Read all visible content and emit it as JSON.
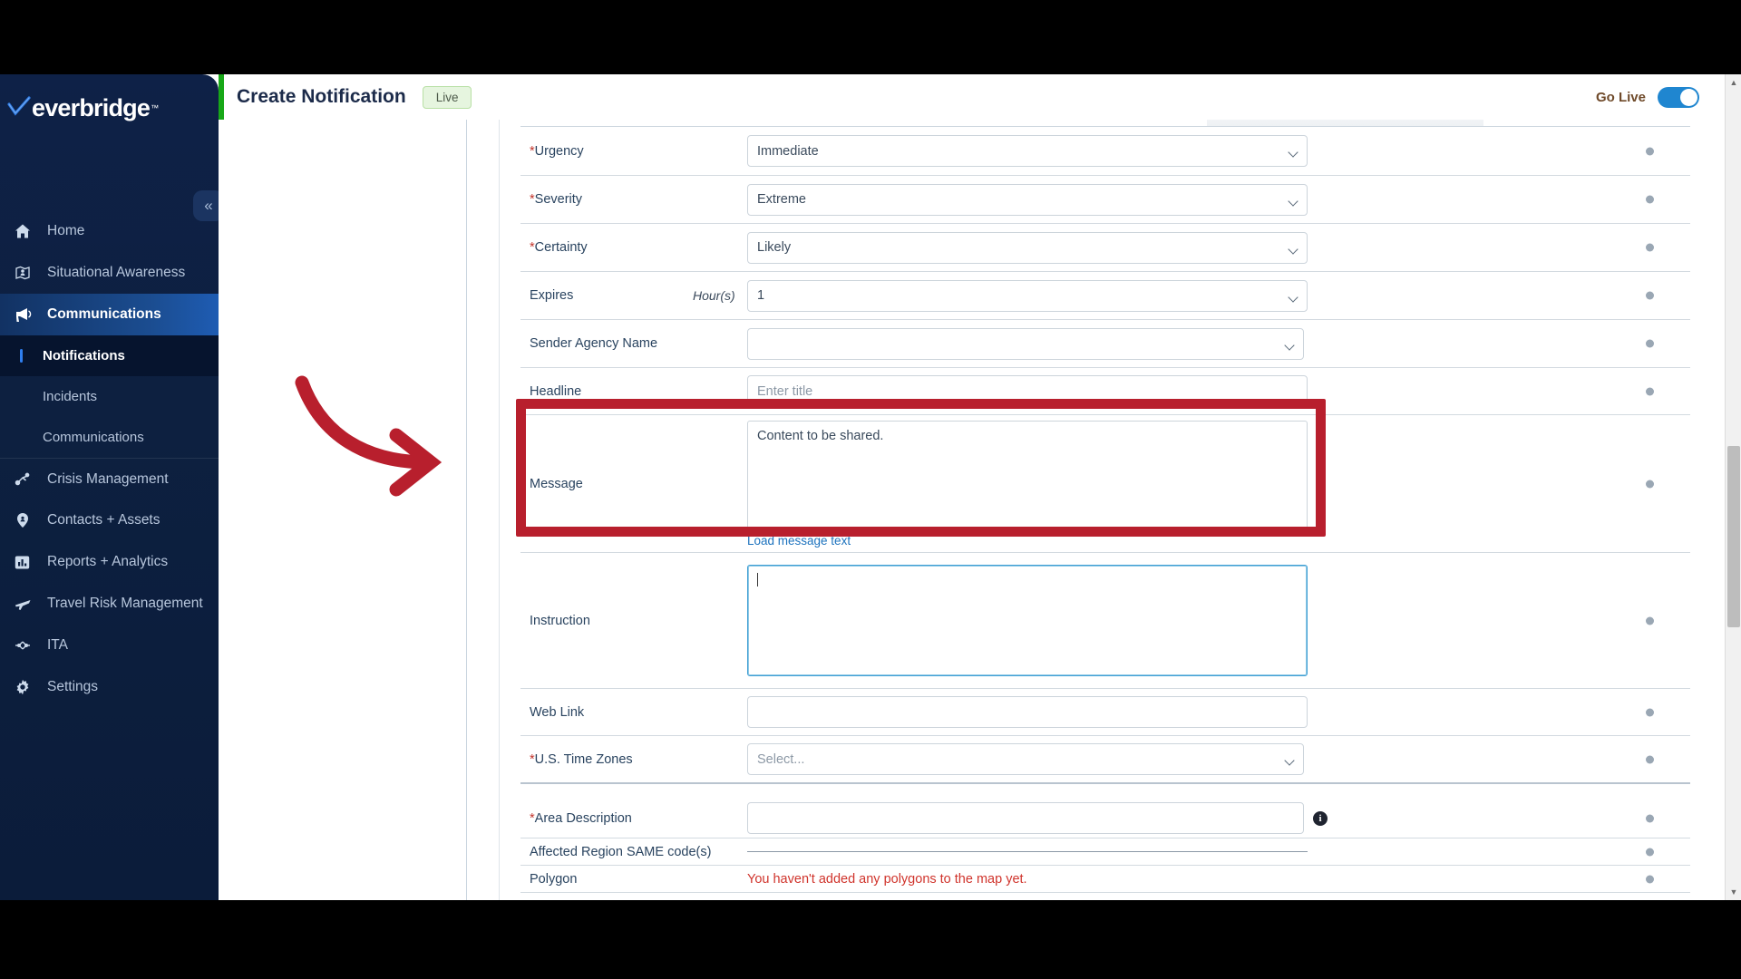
{
  "brand": {
    "name": "everbridge",
    "tm": "™",
    "accent": "#1e5cb3",
    "sidebar_bg": "#0d2040"
  },
  "sidebar": {
    "collapse_label": "«",
    "items": [
      {
        "label": "Home",
        "icon": "home-icon"
      },
      {
        "label": "Situational Awareness",
        "icon": "map-person-icon"
      },
      {
        "label": "Communications",
        "icon": "megaphone-icon",
        "active": true
      }
    ],
    "subitems": [
      {
        "label": "Notifications",
        "current": true
      },
      {
        "label": "Incidents",
        "current": false
      },
      {
        "label": "Communications",
        "current": false
      }
    ],
    "items2": [
      {
        "label": "Crisis Management",
        "icon": "crisis-icon"
      },
      {
        "label": "Contacts + Assets",
        "icon": "pin-person-icon"
      },
      {
        "label": "Reports + Analytics",
        "icon": "bar-chart-icon"
      },
      {
        "label": "Travel Risk Management",
        "icon": "airplane-icon"
      },
      {
        "label": "ITA",
        "icon": "network-icon"
      },
      {
        "label": "Settings",
        "icon": "gear-icon"
      }
    ]
  },
  "header": {
    "title": "Create Notification",
    "badge": "Live",
    "go_live_label": "Go Live",
    "go_live_on": true,
    "accent_green": "#18a818",
    "toggle_color": "#1f86d0"
  },
  "form": {
    "fields": [
      {
        "label": "Urgency",
        "required": true,
        "type": "select",
        "value": "Immediate"
      },
      {
        "label": "Severity",
        "required": true,
        "type": "select",
        "value": "Extreme"
      },
      {
        "label": "Certainty",
        "required": true,
        "type": "select",
        "value": "Likely"
      },
      {
        "label": "Expires",
        "required": false,
        "type": "select",
        "value": "1",
        "note": "Hour(s)"
      },
      {
        "label": "Sender Agency Name",
        "required": false,
        "type": "select",
        "value": ""
      },
      {
        "label": "Headline",
        "required": false,
        "type": "text",
        "value": "",
        "placeholder": "Enter title"
      },
      {
        "label": "Message",
        "required": false,
        "type": "textarea",
        "value": "Content to be shared.",
        "link": "Load message text"
      },
      {
        "label": "Instruction",
        "required": false,
        "type": "textarea",
        "value": "",
        "focused": true
      },
      {
        "label": "Web Link",
        "required": false,
        "type": "text",
        "value": ""
      },
      {
        "label": "U.S. Time Zones",
        "required": true,
        "type": "select",
        "value": "",
        "placeholder": "Select..."
      },
      {
        "label": "Area Description",
        "required": true,
        "type": "text",
        "value": "",
        "info": true
      },
      {
        "label": "Affected Region SAME code(s)",
        "required": false,
        "type": "line",
        "value": ""
      },
      {
        "label": "Polygon",
        "required": false,
        "type": "warning",
        "value": "You haven't added any polygons to the map yet."
      }
    ]
  },
  "annotation": {
    "highlight_color": "#b81f2d",
    "arrow": "curved-right-arrow"
  },
  "scrollbar": {
    "up": "▲",
    "down": "▼"
  }
}
